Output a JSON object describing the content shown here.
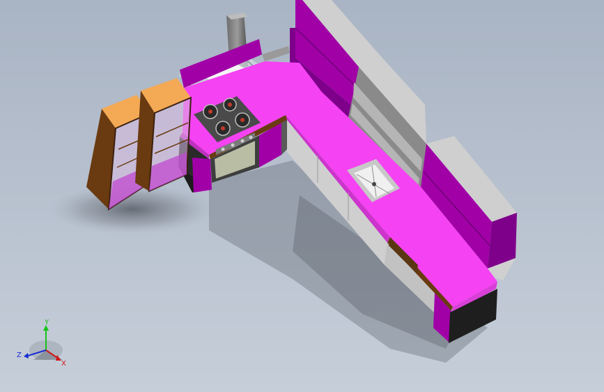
{
  "viewport": {
    "background_top": "#a9b4c4",
    "background_bottom": "#c6ced9"
  },
  "model": {
    "colors": {
      "countertop": "#f542f2",
      "cabinet_purple": "#a100a7",
      "cabinet_purple_dark": "#7e008a",
      "grey_panel": "#cfcfcf",
      "grey_dark": "#8a8a8a",
      "display_top": "#f4a954",
      "display_wood": "#6a3a10",
      "wood_band": "#5a3712",
      "black_plinth": "#1e1e1e",
      "steel": "#8f8f8f"
    },
    "parts": [
      "range-hood",
      "cooktop",
      "oven",
      "sink",
      "wall-cabinets",
      "open-shelf",
      "display-cabinet-left",
      "display-cabinet-right",
      "base-cabinets"
    ]
  },
  "triad": {
    "axes": {
      "y": {
        "label": "Y",
        "color": "#19c21a"
      },
      "x": {
        "label": "X",
        "color": "#d01818"
      },
      "z": {
        "label": "Z",
        "color": "#1a2fd0"
      }
    }
  }
}
